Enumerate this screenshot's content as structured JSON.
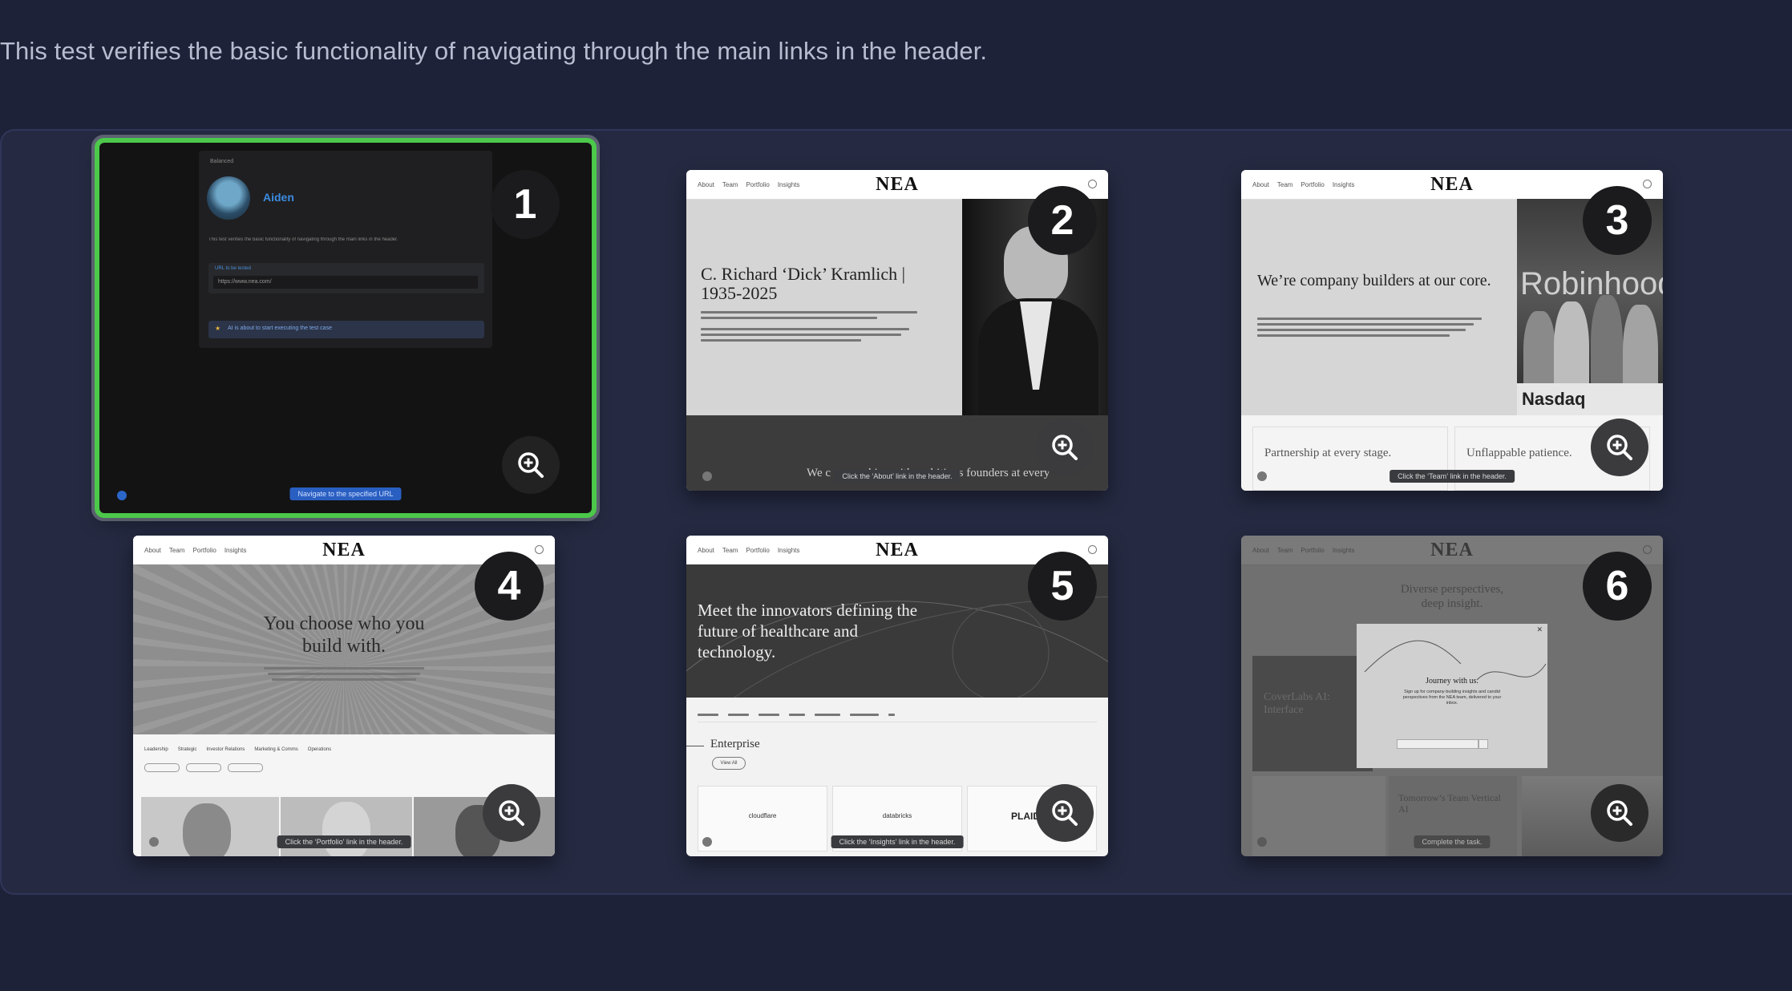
{
  "description": "This test verifies the basic functionality of navigating through the main links in the header.",
  "steps": [
    {
      "number": "1",
      "agent_name": "Aiden",
      "brand_label": "Balanced",
      "intro_text": "This test verifies the basic functionality of navigating through the main links in the header.",
      "url_label": "URL to be tested",
      "url_value": "https://www.nea.com/",
      "status_text": "AI is about to start executing the test case",
      "caption": "Navigate to the specified URL"
    },
    {
      "number": "2",
      "nav": [
        "About",
        "Team",
        "Portfolio",
        "Insights"
      ],
      "logo": "NEA",
      "headline": "C. Richard ‘Dick’ Kramlich | 1935-2025",
      "footer_text": "We c           ships with ambitious founders at every",
      "caption": "Click the ‘About’ link in the header."
    },
    {
      "number": "3",
      "nav": [
        "About",
        "Team",
        "Portfolio",
        "Insights"
      ],
      "logo": "NEA",
      "headline": "We’re company builders at our core.",
      "photo_brand": "Robinhood",
      "photo_sign": "Nasdaq",
      "card_left": "Partnership at every stage.",
      "card_right": "Unflappable patience.",
      "caption": "Click the ‘Team’ link in the header."
    },
    {
      "number": "4",
      "nav": [
        "About",
        "Team",
        "Portfolio",
        "Insights"
      ],
      "logo": "NEA",
      "headline": "You choose who you build with.",
      "filters": [
        "Leadership",
        "Strategic",
        "Investor Relations",
        "Marketing & Comms",
        "Operations"
      ],
      "caption": "Click the ‘Portfolio’ link in the header."
    },
    {
      "number": "5",
      "nav": [
        "About",
        "Team",
        "Portfolio",
        "Insights"
      ],
      "logo": "NEA",
      "headline": "Meet the innovators defining the future of healthcare and technology.",
      "section_title": "Enterprise",
      "view_all": "View All",
      "logos": [
        "cloudflare",
        "databricks",
        "PLAID"
      ],
      "caption": "Click the ‘Insights’ link in the header."
    },
    {
      "number": "6",
      "nav": [
        "About",
        "Team",
        "Portfolio",
        "Insights"
      ],
      "logo": "NEA",
      "headline": "Diverse perspectives, deep insight.",
      "modal_title": "Journey with us.",
      "modal_text": "Sign up for company-building insights and candid perspectives from the NEA team, delivered to your inbox.",
      "side_card": "CoverLabs AI: Interface",
      "bottom_card": "Tomorrow’s Team Vertical AI",
      "caption": "Complete the task."
    }
  ],
  "colors": {
    "page_background": "#1e2238",
    "gallery_background": "#252a42",
    "active_outline": "#4cc84a",
    "badge": "#1b1b1d"
  },
  "icons": {
    "zoom": "zoom-in-icon"
  }
}
